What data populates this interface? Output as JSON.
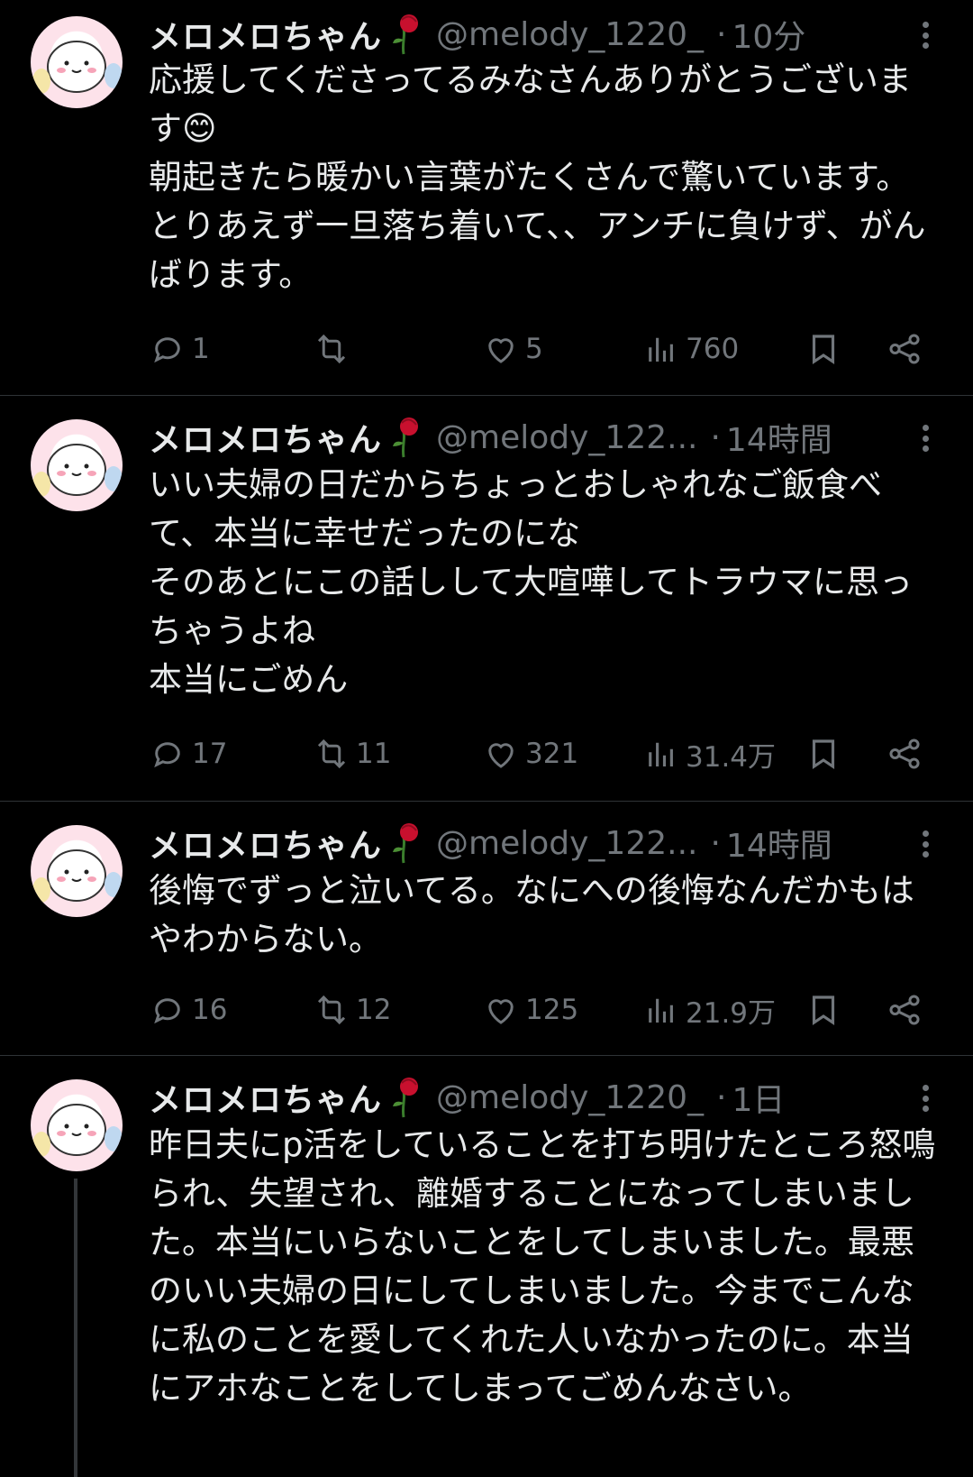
{
  "tweets": [
    {
      "name": "メロメロちゃん",
      "handle": "@melody_1220_",
      "time": "10分",
      "text": "応援してくださってるみなさんありがとうございます😊\n朝起きたら暖かい言葉がたくさんで驚いています。とりあえず一旦落ち着いて、、アンチに負けず、がんばります。",
      "replies": "1",
      "retweets": "",
      "likes": "5",
      "views": "760"
    },
    {
      "name": "メロメロちゃん",
      "handle": "@melody_122...",
      "time": "14時間",
      "text": "いい夫婦の日だからちょっとおしゃれなご飯食べて、本当に幸せだったのにな\nそのあとにこの話しして大喧嘩してトラウマに思っちゃうよね\n本当にごめん",
      "replies": "17",
      "retweets": "11",
      "likes": "321",
      "views": "31.4万"
    },
    {
      "name": "メロメロちゃん",
      "handle": "@melody_122...",
      "time": "14時間",
      "text": "後悔でずっと泣いてる。なにへの後悔なんだかもはやわからない。",
      "replies": "16",
      "retweets": "12",
      "likes": "125",
      "views": "21.9万"
    },
    {
      "name": "メロメロちゃん",
      "handle": "@melody_1220_",
      "time": "1日",
      "text": "昨日夫にp活をしていることを打ち明けたところ怒鳴られ、失望され、離婚することになってしまいました。本当にいらないことをしてしまいました。最悪のいい夫婦の日にしてしまいました。今までこんなに私のことを愛してくれた人いなかったのに。本当にアホなことをしてしまってごめんなさい。"
    }
  ],
  "colors": {
    "background": "#000000",
    "text": "#e7e9ea",
    "muted": "#71767b",
    "divider": "#2f3336"
  },
  "icons": [
    "avatar-character-icon",
    "wilted-rose-icon",
    "more-icon",
    "reply-icon",
    "retweet-icon",
    "like-icon",
    "views-icon",
    "bookmark-icon",
    "share-icon"
  ]
}
